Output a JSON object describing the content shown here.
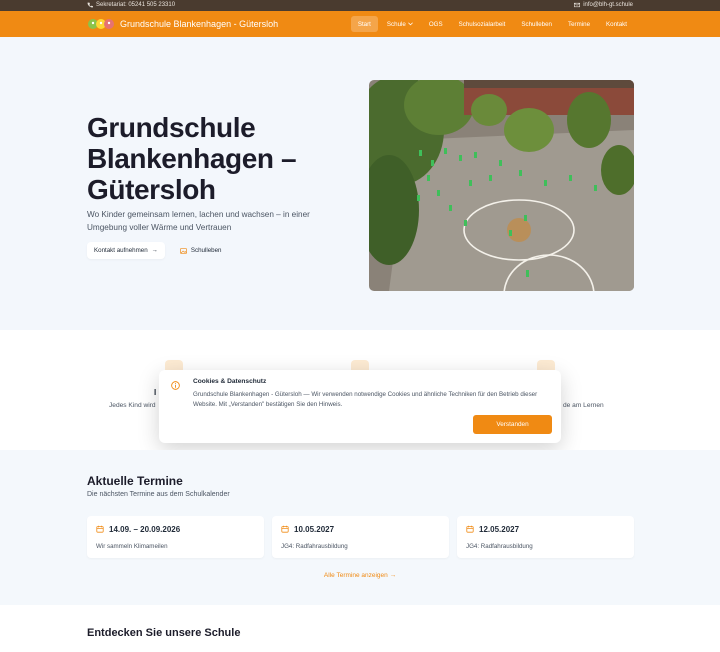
{
  "topbar": {
    "phone": "Sekretariat: 05241 505 23310",
    "email": "info@blh-gt.schule"
  },
  "nav": {
    "brand": "Grundschule Blankenhagen - Gütersloh",
    "items": [
      {
        "label": "Start",
        "active": true
      },
      {
        "label": "Schule",
        "dropdown": true
      },
      {
        "label": "OGS"
      },
      {
        "label": "Schulsozialarbeit"
      },
      {
        "label": "Schulleben"
      },
      {
        "label": "Termine"
      },
      {
        "label": "Kontakt"
      }
    ]
  },
  "hero": {
    "title": "Grundschule Blankenhagen – Gütersloh",
    "subtitle": "Wo Kinder gemeinsam lernen, lachen und wachsen – in einer Umgebung voller Wärme und Vertrauen",
    "primary_button": "Kontakt aufnehmen",
    "primary_arrow": "→",
    "secondary_button": "Schulleben"
  },
  "features": {
    "left_head": "I",
    "left_text": "Jedes Kind wird",
    "right_text": "de am Lernen"
  },
  "cookie": {
    "title": "Cookies & Datenschutz",
    "text": "Grundschule Blankenhagen - Gütersloh — Wir verwenden notwendige Cookies und ähnliche Techniken für den Betrieb dieser Website. Mit „Verstanden\" bestätigen Sie den Hinweis.",
    "button": "Verstanden"
  },
  "events": {
    "title": "Aktuelle Termine",
    "lead": "Die nächsten Termine aus dem Schulkalender",
    "cards": [
      {
        "date": "14.09. – 20.09.2026",
        "desc": "Wir sammeln Klimameilen"
      },
      {
        "date": "10.05.2027",
        "desc": "JG4: Radfahrausbildung"
      },
      {
        "date": "12.05.2027",
        "desc": "JG4: Radfahrausbildung"
      }
    ],
    "all_link": "Alle Termine anzeigen →"
  },
  "discover": {
    "title": "Entdecken Sie unsere Schule"
  },
  "colors": {
    "accent": "#f08a13",
    "topbar": "#4a3b2f",
    "hero_bg": "#f3f7fc"
  }
}
